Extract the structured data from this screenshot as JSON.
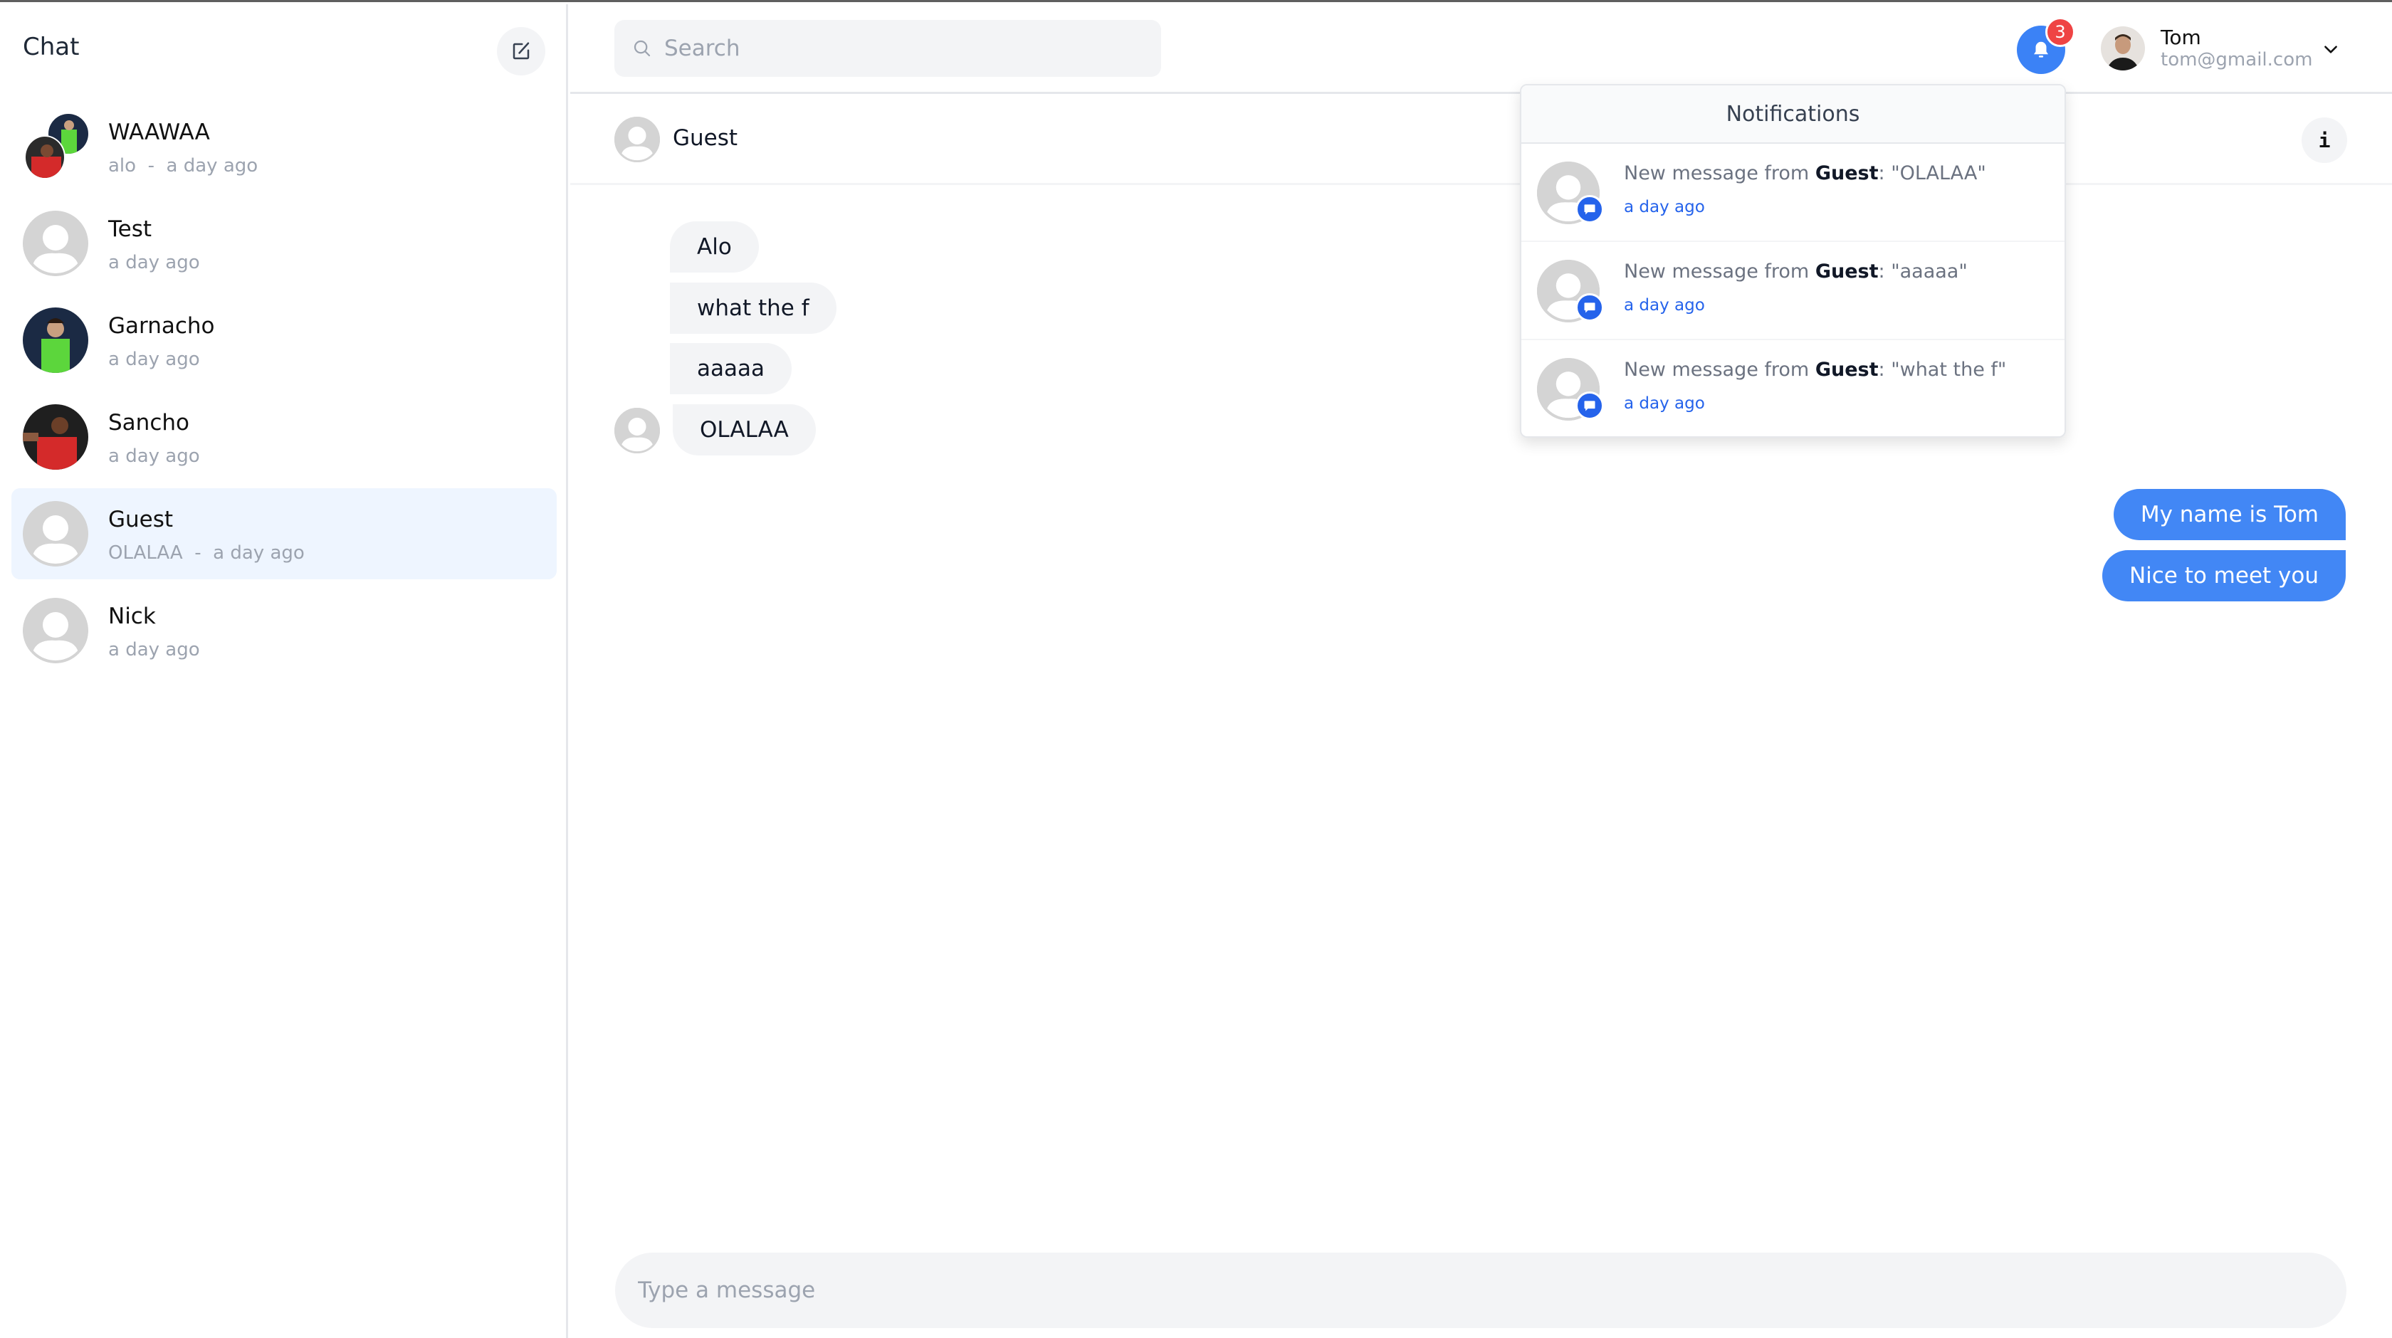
{
  "sidebar": {
    "title": "Chat",
    "compose_icon": "edit-square-icon",
    "chats": [
      {
        "name": "WAAWAA",
        "preview": "alo",
        "time": "a day ago",
        "avatar": "group-photo",
        "active": false
      },
      {
        "name": "Test",
        "preview": "",
        "time": "a day ago",
        "avatar": "default-user",
        "active": false
      },
      {
        "name": "Garnacho",
        "preview": "",
        "time": "a day ago",
        "avatar": "photo-green-kit",
        "active": false
      },
      {
        "name": "Sancho",
        "preview": "",
        "time": "a day ago",
        "avatar": "photo-red-kit",
        "active": false
      },
      {
        "name": "Guest",
        "preview": "OLALAA",
        "time": "a day ago",
        "avatar": "default-user",
        "active": true
      },
      {
        "name": "Nick",
        "preview": "",
        "time": "a day ago",
        "avatar": "default-user",
        "active": false
      }
    ],
    "separator": "  -  "
  },
  "topbar": {
    "search_placeholder": "Search",
    "notification_count": "3",
    "user": {
      "name": "Tom",
      "email": "tom@gmail.com"
    }
  },
  "chat": {
    "title": "Guest",
    "info_label": "i",
    "incoming": [
      "Alo",
      "what the f",
      "aaaaa",
      "OLALAA"
    ],
    "outgoing": [
      "My name is Tom",
      "Nice to meet you"
    ],
    "composer_placeholder": "Type a message"
  },
  "notifications": {
    "title": "Notifications",
    "items": [
      {
        "prefix": "New message from ",
        "sender": "Guest",
        "message": ": \"OLALAA\"",
        "time": "a day ago"
      },
      {
        "prefix": "New message from ",
        "sender": "Guest",
        "message": ": \"aaaaa\"",
        "time": "a day ago"
      },
      {
        "prefix": "New message from ",
        "sender": "Guest",
        "message": ": \"what the f\"",
        "time": "a day ago"
      }
    ]
  },
  "colors": {
    "accent": "#3b82f6",
    "outgoing_bubble": "#4287f5",
    "badge": "#ef4444",
    "active_chat_bg": "#eef5ff",
    "notif_time": "#2563eb"
  }
}
